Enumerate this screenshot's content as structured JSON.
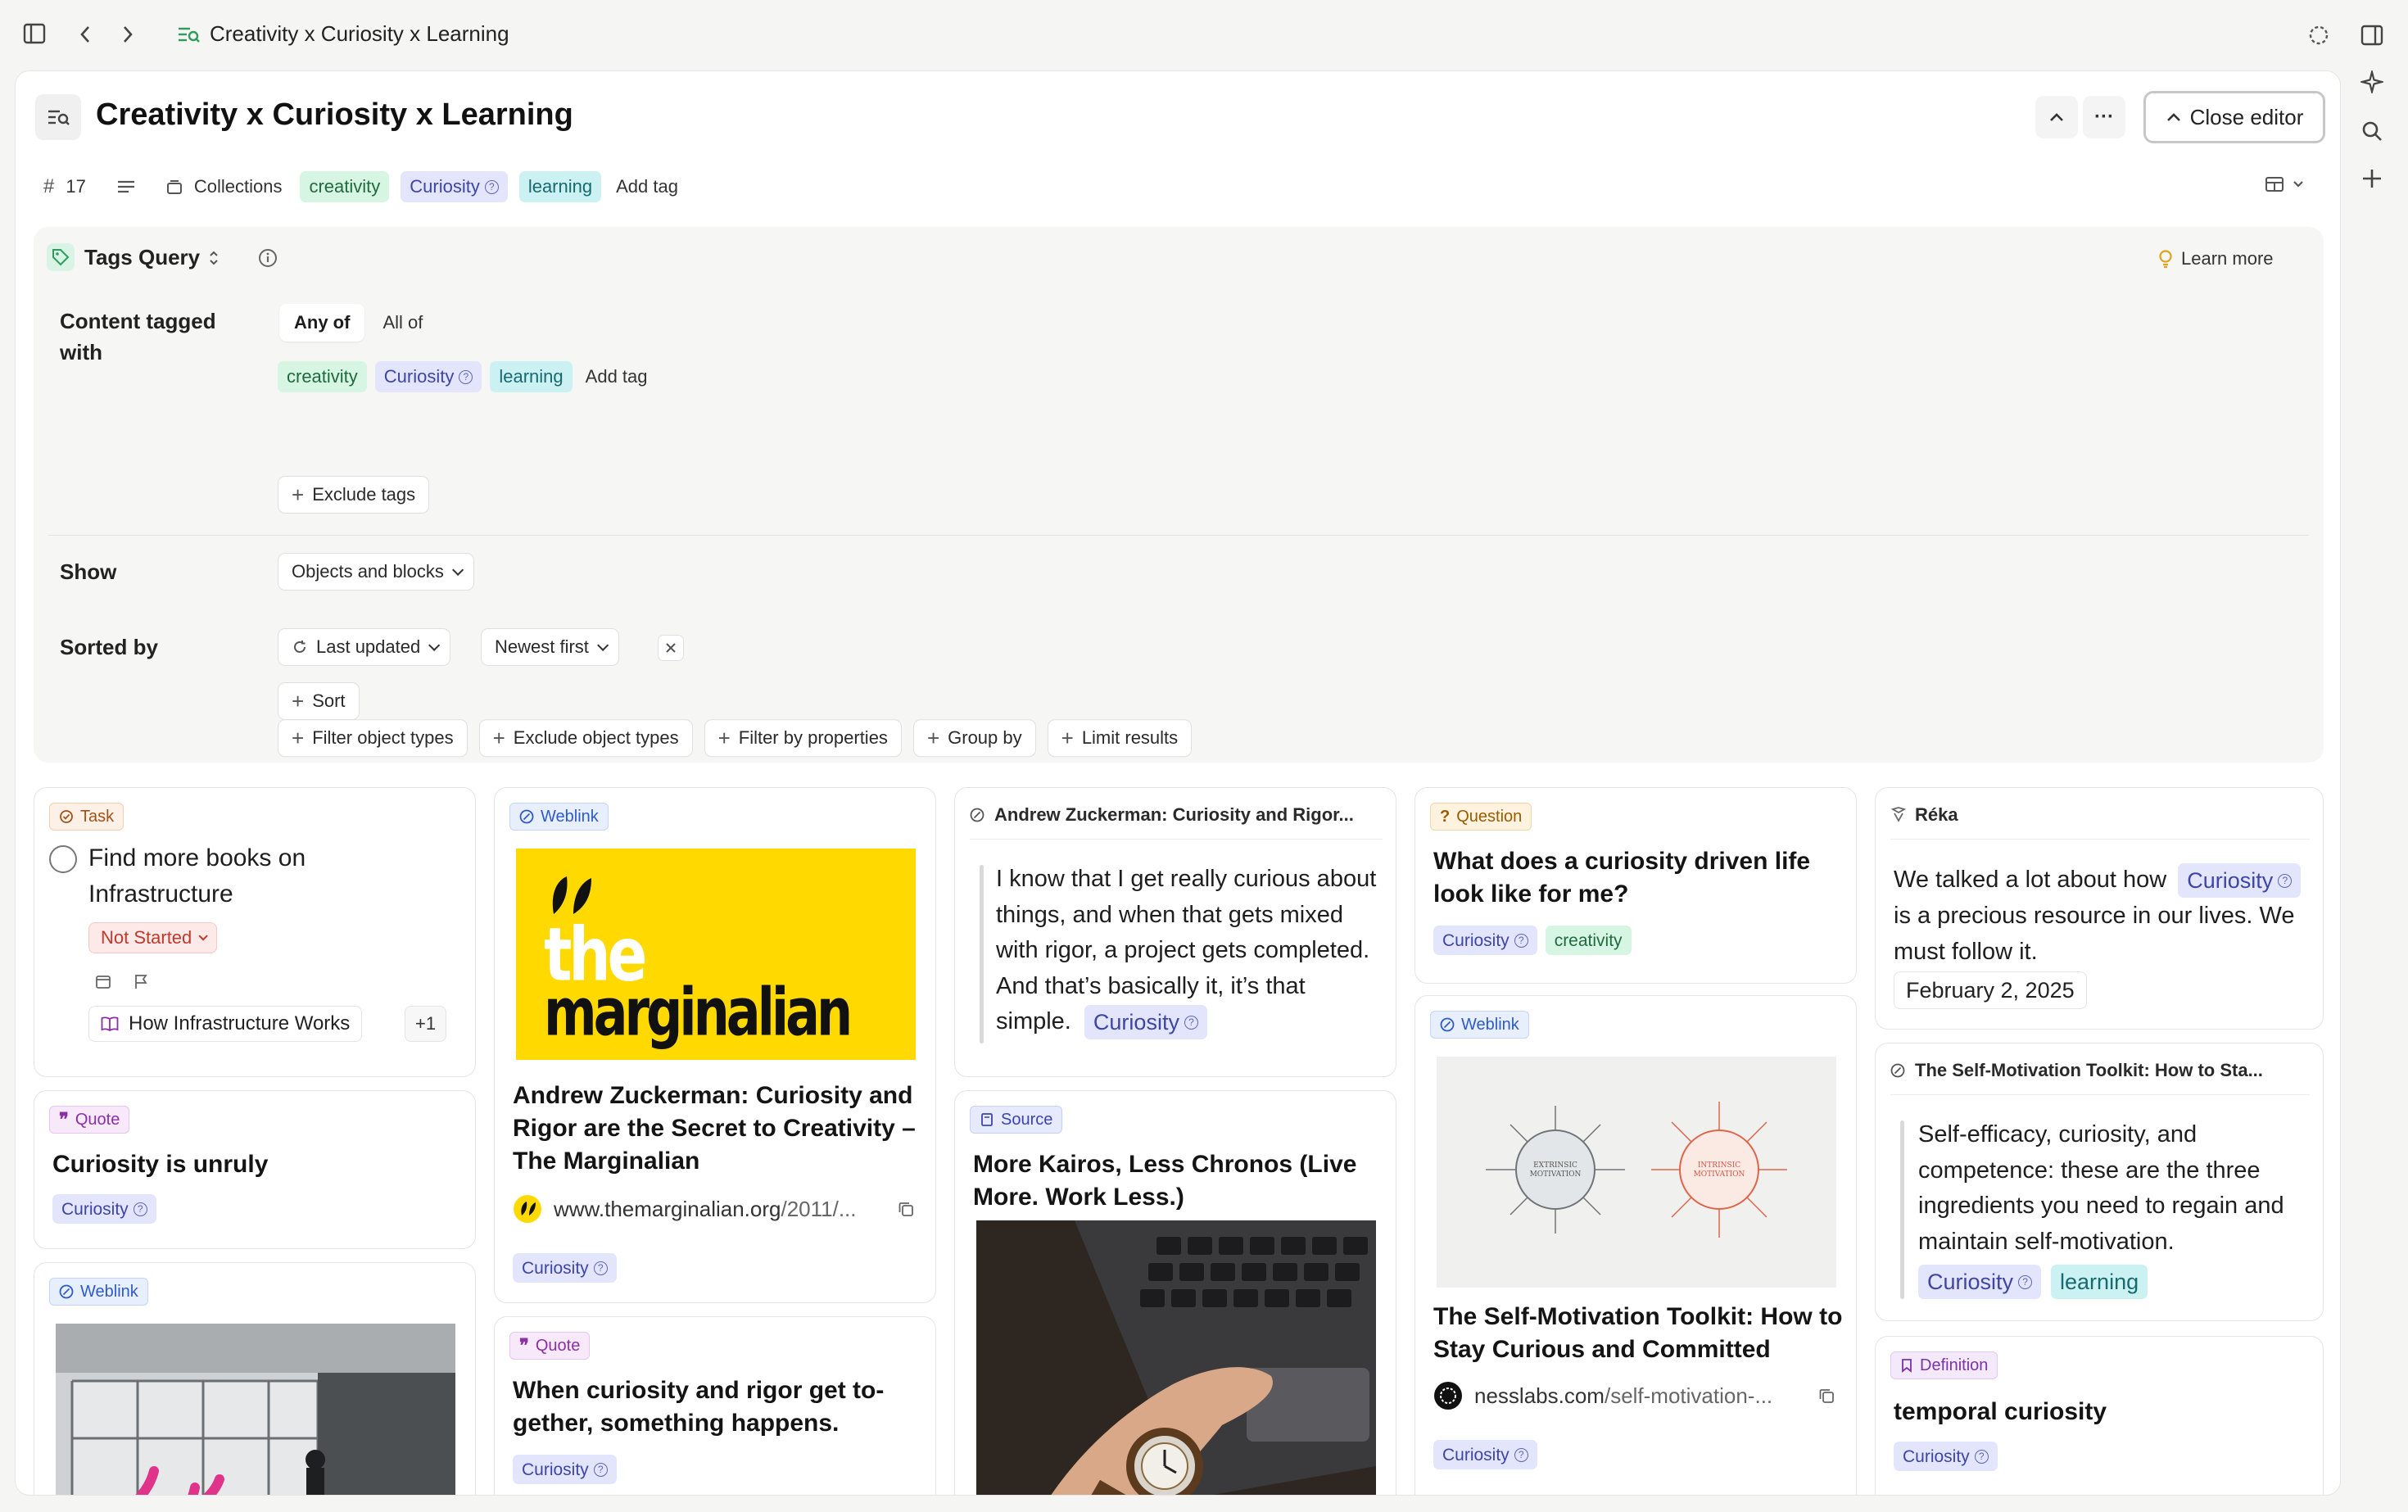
{
  "window": {
    "breadcrumb_title": "Creativity x Curiosity x Learning"
  },
  "header": {
    "title": "Creativity x Curiosity x Learning",
    "close_editor_label": "Close editor",
    "more_label": "···"
  },
  "meta": {
    "count": "17",
    "collections_label": "Collections",
    "tags": [
      "creativity",
      "Curiosity",
      "learning"
    ],
    "add_tag": "Add tag"
  },
  "query": {
    "title": "Tags Query",
    "learn_more": "Learn more",
    "content_tagged_label": "Content tagged with",
    "any_of": "Any of",
    "all_of": "All of",
    "tags": [
      "creativity",
      "Curiosity",
      "learning"
    ],
    "add_tag": "Add tag",
    "exclude_tags": "Exclude tags",
    "show_label": "Show",
    "show_value": "Objects and blocks",
    "sorted_by_label": "Sorted by",
    "sort_field": "Last updated",
    "sort_order": "Newest first",
    "add_sort": "Sort",
    "actions": [
      "Filter object types",
      "Exclude object types",
      "Filter by properties",
      "Group by",
      "Limit results"
    ]
  },
  "cards": {
    "task": {
      "badge": "Task",
      "title": "Find more books on Infrastructure",
      "status": "Not Started",
      "link": "How Infrastructure Works",
      "extra": "+1"
    },
    "quote1": {
      "badge": "Quote",
      "title": "Curiosity is unruly",
      "tag": "Curiosity"
    },
    "weblink_bottom": {
      "badge": "Weblink"
    },
    "marginalian": {
      "badge": "Weblink",
      "logo_line1": "the",
      "logo_line2": "marginalian",
      "title": "Andrew Zuckerman: Curiosity and Rigor are the Secret to Creativity – The Marginalian",
      "url_domain": "www.themarginalian.org",
      "url_rest": "/2011/...",
      "tag": "Curiosity"
    },
    "quote2": {
      "badge": "Quote",
      "title": "When curiosity and rigor get to-gether, something happens.",
      "tag": "Curiosity"
    },
    "highlight1": {
      "head": "Andrew Zuckerman: Curiosity and Rigor...",
      "text": "I know that I get really curious about things, and when that gets mixed with rigor, a project gets completed. And that’s basically it, it’s that simple.",
      "tag": "Curiosity"
    },
    "source": {
      "badge": "Source",
      "title": "More Kairos, Less Chronos (Live More. Work Less.)"
    },
    "question": {
      "badge": "Question",
      "title": "What does a curiosity driven life look like for me?",
      "tags": [
        "Curiosity",
        "creativity"
      ]
    },
    "selfmot_web": {
      "badge": "Weblink",
      "diagram_left": "EXTRINSIC",
      "diagram_left2": "MOTIVATION",
      "diagram_right": "INTRINSIC",
      "diagram_right2": "MOTIVATION",
      "title": "The Self-Motivation Toolkit: How to Stay Curious and Committed",
      "url_domain": "nesslabs.com",
      "url_rest": "/self-motivation-...",
      "tag": "Curiosity"
    },
    "reka": {
      "head": "Réka",
      "text_before": "We talked a lot about how",
      "tag": "Curiosity",
      "text_after": "is a precious resource in our lives. We must follow it.",
      "date": "February 2, 2025"
    },
    "highlight2": {
      "head": "The Self-Motivation Toolkit: How to Sta...",
      "text": "Self-efficacy, curiosity, and competence: these are the three ingredients you need to regain and maintain self-motivation.",
      "tags": [
        "Curiosity",
        "learning"
      ]
    },
    "definition": {
      "badge": "Definition",
      "title": "temporal curiosity",
      "tag": "Curiosity"
    }
  },
  "colors": {
    "accent_green": "#1f6b3e",
    "tag_green_bg": "#d7f5e3",
    "tag_blue_bg": "#e2e5fb",
    "tag_teal_bg": "#cbf1f3",
    "marginalian_yellow": "#ffd900"
  }
}
